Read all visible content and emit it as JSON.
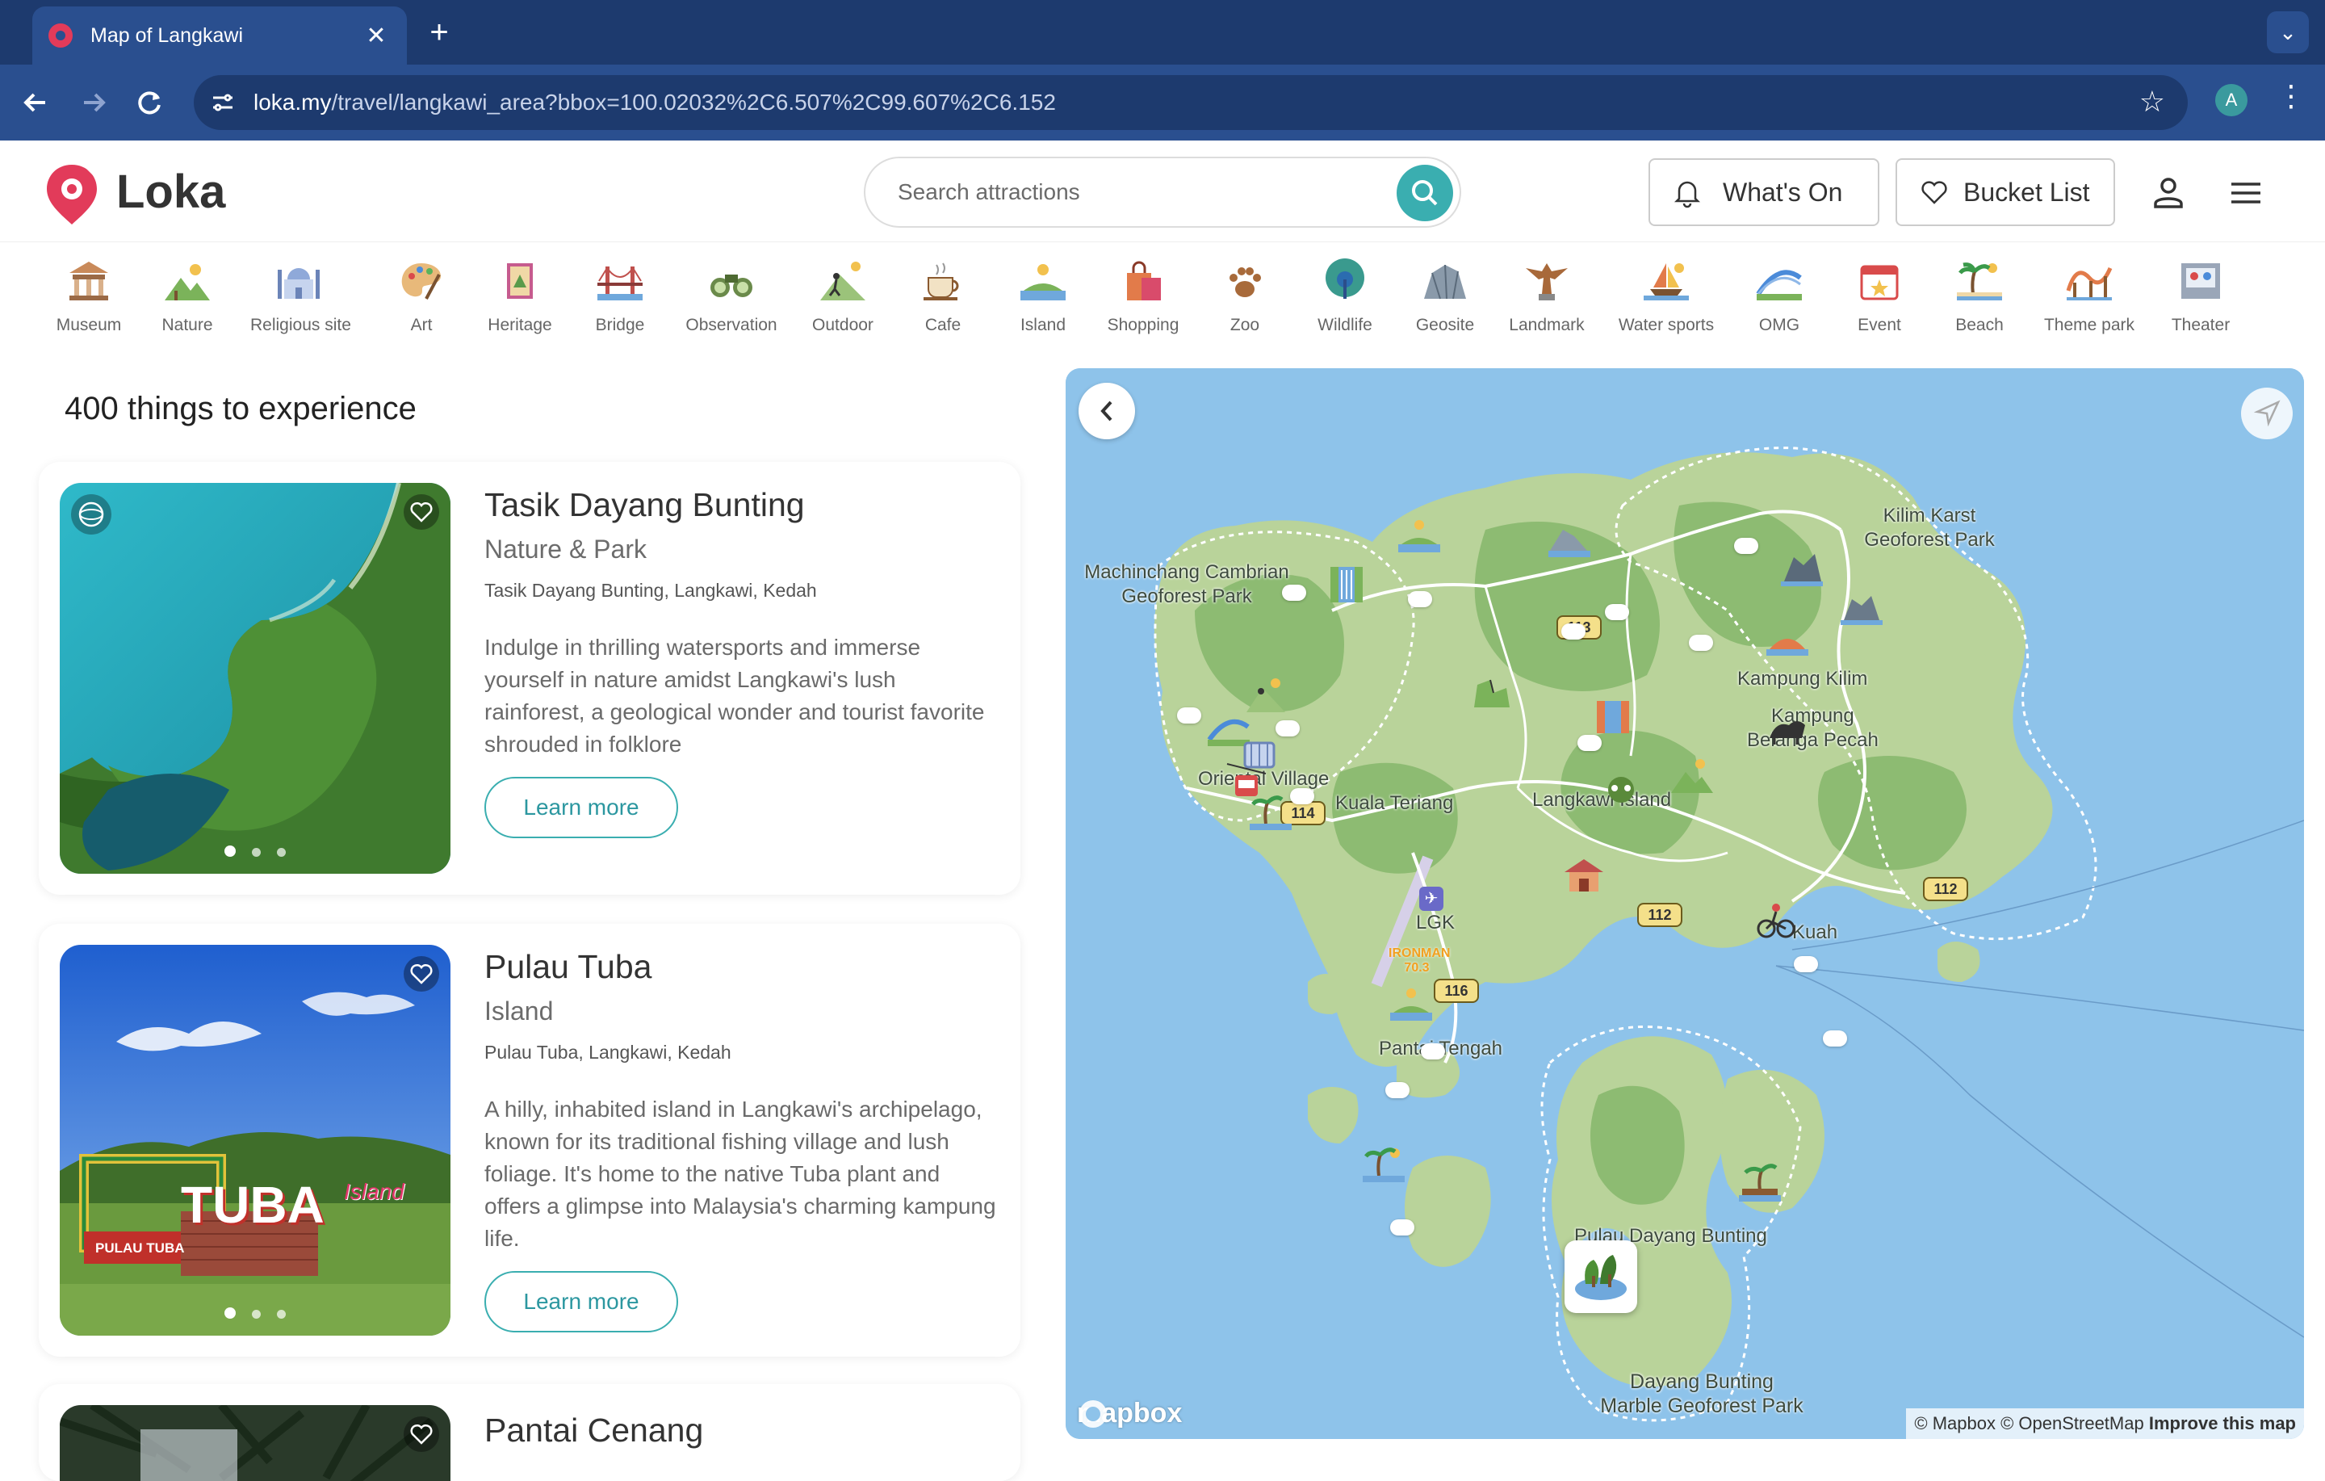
{
  "browser": {
    "tab_title": "Map of Langkawi",
    "tab_close": "✕",
    "new_tab": "+",
    "url_domain": "loka.my",
    "url_path": "/travel/langkawi_area?bbox=100.02032%2C6.507%2C99.607%2C6.152",
    "profile_initial": "A"
  },
  "header": {
    "logo_text": "Loka",
    "search_placeholder": "Search attractions",
    "whats_on_label": "What's On",
    "bucket_list_label": "Bucket List"
  },
  "categories": [
    {
      "label": "Museum",
      "icon": "museum-icon"
    },
    {
      "label": "Nature",
      "icon": "nature-icon"
    },
    {
      "label": "Religious site",
      "icon": "religious-site-icon"
    },
    {
      "label": "Art",
      "icon": "art-icon"
    },
    {
      "label": "Heritage",
      "icon": "heritage-icon"
    },
    {
      "label": "Bridge",
      "icon": "bridge-icon"
    },
    {
      "label": "Observation",
      "icon": "binoculars-icon"
    },
    {
      "label": "Outdoor",
      "icon": "outdoor-icon"
    },
    {
      "label": "Cafe",
      "icon": "cafe-icon"
    },
    {
      "label": "Island",
      "icon": "island-icon"
    },
    {
      "label": "Shopping",
      "icon": "shopping-icon"
    },
    {
      "label": "Zoo",
      "icon": "paw-icon"
    },
    {
      "label": "Wildlife",
      "icon": "peacock-icon"
    },
    {
      "label": "Geosite",
      "icon": "geosite-icon"
    },
    {
      "label": "Landmark",
      "icon": "landmark-icon"
    },
    {
      "label": "Water sports",
      "icon": "water-sports-icon"
    },
    {
      "label": "OMG",
      "icon": "omg-icon"
    },
    {
      "label": "Event",
      "icon": "event-icon"
    },
    {
      "label": "Beach",
      "icon": "beach-icon"
    },
    {
      "label": "Theme park",
      "icon": "theme-park-icon"
    },
    {
      "label": "Theater",
      "icon": "theater-icon"
    }
  ],
  "listing": {
    "title": "400 things to experience",
    "learn_more": "Learn more",
    "cards": [
      {
        "title": "Tasik Dayang Bunting",
        "category": "Nature & Park",
        "location": "Tasik Dayang Bunting, Langkawi, Kedah",
        "description": "Indulge in thrilling watersports and immerse yourself in nature amidst Langkawi's lush rainforest, a geological wonder and tourist favorite shrouded in folklore"
      },
      {
        "title": "Pulau Tuba",
        "category": "Island",
        "location": "Pulau Tuba, Langkawi, Kedah",
        "description": "A hilly, inhabited island in Langkawi's archipelago, known for its traditional fishing village and lush foliage. It's home to the native Tuba plant and offers a glimpse into Malaysia's charming kampung life.",
        "sign_text_main": "TUBA",
        "sign_text_script": "Island",
        "sign_text_small": "PULAU TUBA"
      },
      {
        "title": "Pantai Cenang"
      }
    ]
  },
  "map": {
    "labels": {
      "machinchang": "Machinchang Cambrian\nGeoforest Park",
      "kilim_karst": "Kilim Karst\nGeoforest Park",
      "kampung_kilim": "Kampung Kilim",
      "kampung_belanga": "Kampung\nBelanga Pecah",
      "oriental_village": "Oriental Village",
      "kuala_teriang": "Kuala Teriang",
      "langkawi_island": "Langkawi Island",
      "lgk": "LGK",
      "kuah": "Kuah",
      "pantai_tengah": "Pantai Tengah",
      "pulau_dayang_bunting": "Pulau Dayang Bunting",
      "dayang_bunting_marble": "Dayang Bunting\nMarble Geoforest Park",
      "ironman": "IRONMAN\n70.3"
    },
    "roads": [
      "113",
      "114",
      "112",
      "112",
      "116"
    ],
    "mapbox_logo": "mapbox",
    "attribution": "© Mapbox © OpenStreetMap",
    "improve": "Improve this map"
  },
  "colors": {
    "brand": "#e23b5a",
    "accent": "#3aaeb0",
    "chrome": "#2a4f8f",
    "sea": "#8ec3ea",
    "land": "#b9d39a"
  }
}
